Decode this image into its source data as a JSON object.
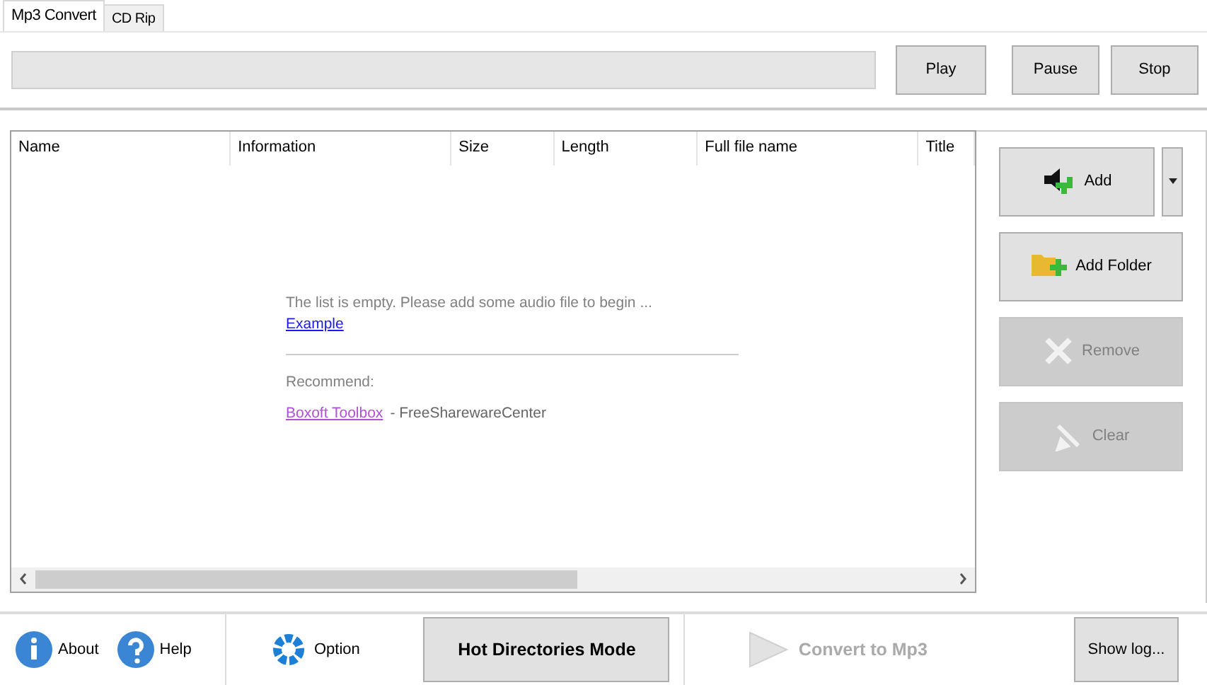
{
  "tabs": [
    {
      "label": "Mp3 Convert",
      "selected": true
    },
    {
      "label": "CD Rip",
      "selected": false
    }
  ],
  "player": {
    "progress": {
      "level": 0
    },
    "buttons": [
      {
        "label": "Play",
        "disabled": false
      },
      {
        "label": "Pause",
        "disabled": false
      },
      {
        "label": "Stop",
        "disabled": false
      }
    ]
  },
  "table": {
    "columns": [
      "Name",
      "Information",
      "Size",
      "Length",
      "Full file name",
      "Title"
    ],
    "empty_message": "The list is empty. Please add some audio file to begin ...",
    "example_link": "Example",
    "recommend_label": "Recommend:",
    "recommend_link": "Boxoft Toolbox",
    "recommend_source": "- FreeSharewareCenter"
  },
  "side_buttons": [
    {
      "label": "Add",
      "kind": "speaker",
      "disabled": false
    },
    {
      "label": "Add Folder",
      "kind": "folder",
      "disabled": false
    },
    {
      "label": "Remove",
      "kind": "remove",
      "disabled": true
    },
    {
      "label": "Clear",
      "kind": "clear",
      "disabled": true
    }
  ],
  "bottom": {
    "about": "About",
    "help": "Help",
    "option": "Option",
    "mode_button": "Hot Directories Mode",
    "convert": {
      "label": "Convert to Mp3",
      "disabled": true
    },
    "log_button": "Show log..."
  }
}
